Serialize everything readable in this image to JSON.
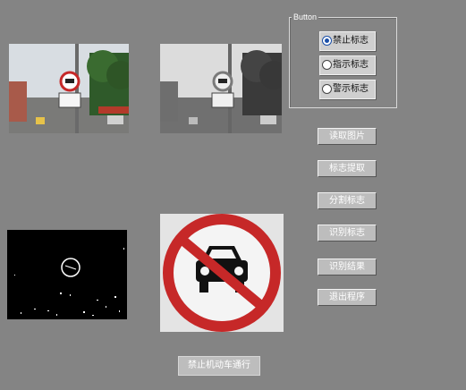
{
  "group": {
    "title": "Button"
  },
  "radios": [
    {
      "label": "禁止标志",
      "checked": true
    },
    {
      "label": "指示标志",
      "checked": false
    },
    {
      "label": "警示标志",
      "checked": false
    }
  ],
  "buttons": {
    "read_image": "读取图片",
    "extract_sign": "标志提取",
    "segment_sign": "分割标志",
    "recognize_sign": "识别标志",
    "recognition_result": "识别结果",
    "exit_program": "退出程序"
  },
  "result": {
    "text": "禁止机动车通行"
  },
  "colors": {
    "background": "#848484",
    "accent": "#1a4fa8",
    "sign_red": "#c62828"
  }
}
